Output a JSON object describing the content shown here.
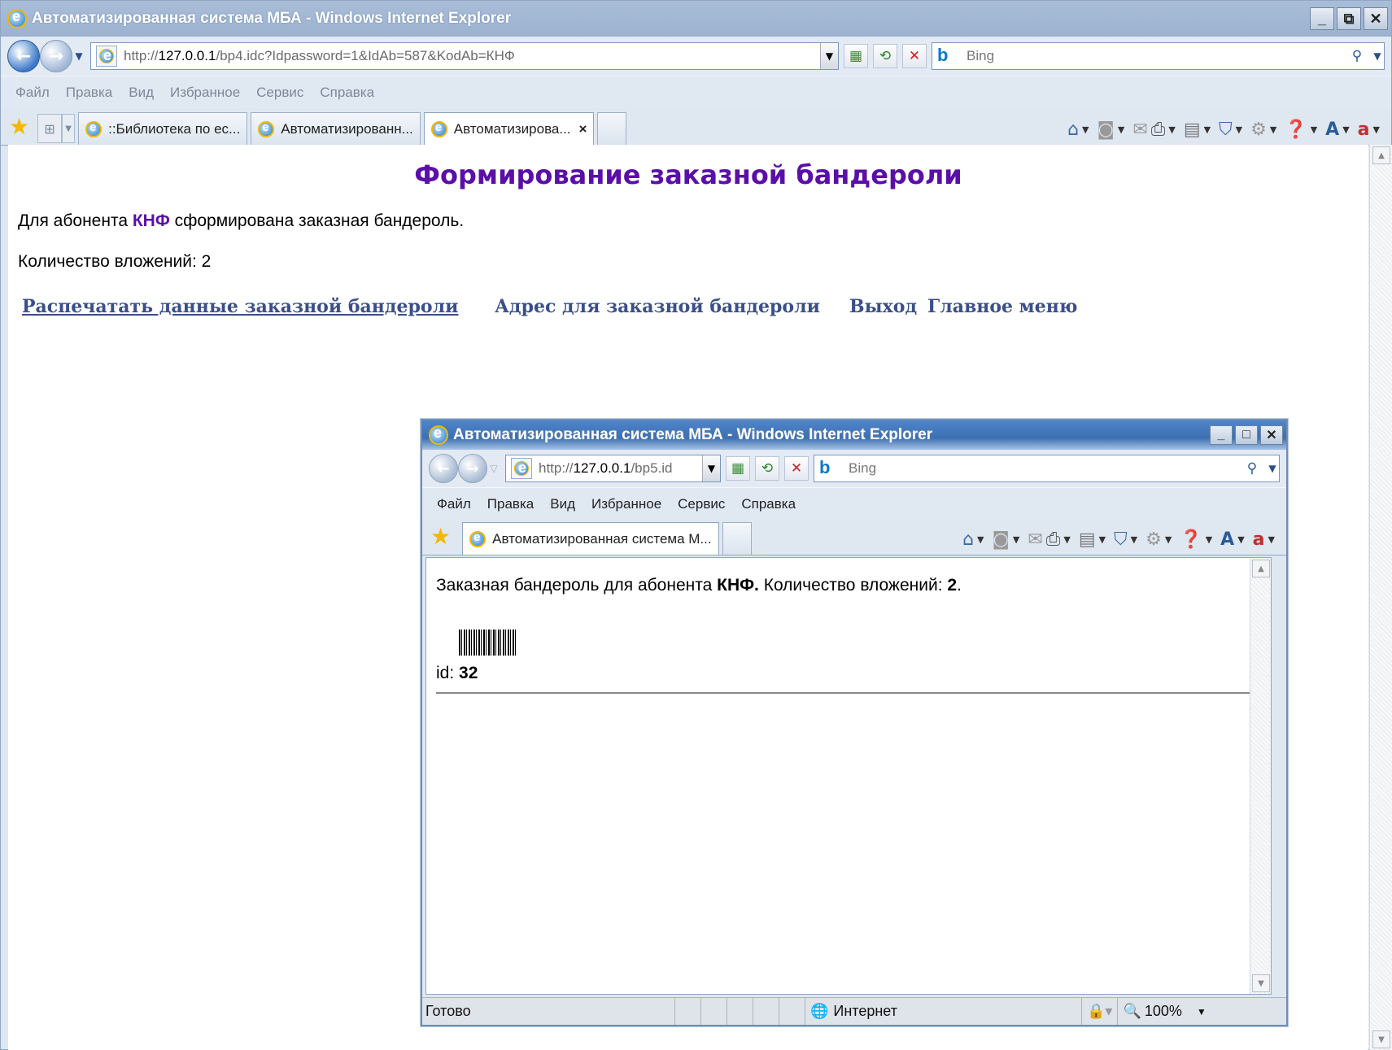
{
  "main_window": {
    "title": "Автоматизированная система МБА - Windows Internet Explorer",
    "url_prefix": "http://",
    "url_host": "127.0.0.1",
    "url_rest": "/bp4.idc?Idpassword=1&IdAb=587&KodAb=КНФ",
    "search_placeholder": "Bing",
    "menu": [
      "Файл",
      "Правка",
      "Вид",
      "Избранное",
      "Сервис",
      "Справка"
    ],
    "tabs": [
      {
        "label": "::Библиотека по ес..."
      },
      {
        "label": "Автоматизированн..."
      },
      {
        "label": "Автоматизирова...",
        "close": "×"
      }
    ]
  },
  "page": {
    "heading": "Формирование заказной бандероли",
    "line1_prefix": "Для абонента ",
    "line1_code": "КНФ",
    "line1_suffix": " сформирована заказная бандероль.",
    "line2": "Количество вложений: 2",
    "links": {
      "print": "Распечатать данные заказной бандероли",
      "address": "Адрес для заказной бандероли",
      "exit": "Выход",
      "main_menu": "Главное меню"
    }
  },
  "popup": {
    "title": "Автоматизированная система МБА - Windows Internet Explorer",
    "url_prefix": "http://",
    "url_host": "127.0.0.1",
    "url_rest": "/bp5.id",
    "search_placeholder": "Bing",
    "menu": [
      "Файл",
      "Правка",
      "Вид",
      "Избранное",
      "Сервис",
      "Справка"
    ],
    "tab_label": "Автоматизированная система М...",
    "content": {
      "line_prefix": "Заказная бандероль для абонента ",
      "code": "КНФ.",
      "line_middle": " Количество вложений: ",
      "count": "2",
      "line_end": ".",
      "id_label": "id: ",
      "id_value": "32"
    },
    "status": {
      "text": "Готово",
      "zone": "Интернет",
      "zoom": "100%"
    }
  }
}
